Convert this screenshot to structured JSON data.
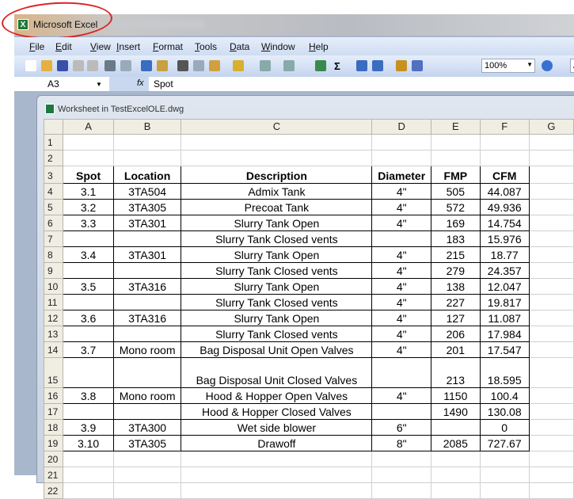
{
  "window": {
    "title": "Microsoft Excel"
  },
  "menu": [
    "File",
    "Edit",
    "View",
    "Insert",
    "Format",
    "Tools",
    "Data",
    "Window",
    "Help"
  ],
  "toolbar": {
    "zoom": "100%",
    "font": "Aria"
  },
  "formula_bar": {
    "cell": "A3",
    "fx": "fx",
    "value": "Spot"
  },
  "worksheet": {
    "title": "Worksheet in TestExcelOLE.dwg",
    "columns": [
      "A",
      "B",
      "C",
      "D",
      "E",
      "F",
      "G"
    ],
    "rows": [
      {
        "n": "1",
        "cells": [
          "",
          "",
          "",
          "",
          "",
          ""
        ]
      },
      {
        "n": "2",
        "cells": [
          "",
          "",
          "",
          "",
          "",
          ""
        ]
      },
      {
        "n": "3",
        "cells": [
          "Spot",
          "Location",
          "Description",
          "Diameter",
          "FMP",
          "CFM"
        ]
      },
      {
        "n": "4",
        "cells": [
          "3.1",
          "3TA504",
          "Admix Tank",
          "4\"",
          "505",
          "44.087"
        ]
      },
      {
        "n": "5",
        "cells": [
          "3.2",
          "3TA305",
          "Precoat Tank",
          "4\"",
          "572",
          "49.936"
        ]
      },
      {
        "n": "6",
        "cells": [
          "3.3",
          "3TA301",
          "Slurry Tank Open",
          "4\"",
          "169",
          "14.754"
        ]
      },
      {
        "n": "7",
        "cells": [
          "",
          "",
          "Slurry Tank Closed vents",
          "",
          "183",
          "15.976"
        ]
      },
      {
        "n": "8",
        "cells": [
          "3.4",
          "3TA301",
          "Slurry Tank Open",
          "4\"",
          "215",
          "18.77"
        ]
      },
      {
        "n": "9",
        "cells": [
          "",
          "",
          "Slurry Tank Closed vents",
          "4\"",
          "279",
          "24.357"
        ]
      },
      {
        "n": "10",
        "cells": [
          "3.5",
          "3TA316",
          "Slurry Tank Open",
          "4\"",
          "138",
          "12.047"
        ]
      },
      {
        "n": "11",
        "cells": [
          "",
          "",
          "Slurry Tank Closed vents",
          "4\"",
          "227",
          "19.817"
        ]
      },
      {
        "n": "12",
        "cells": [
          "3.6",
          "3TA316",
          "Slurry Tank Open",
          "4\"",
          "127",
          "11.087"
        ]
      },
      {
        "n": "13",
        "cells": [
          "",
          "",
          "Slurry Tank Closed vents",
          "4\"",
          "206",
          "17.984"
        ]
      },
      {
        "n": "14",
        "cells": [
          "3.7",
          "Mono room",
          "Bag Disposal Unit Open Valves",
          "4\"",
          "201",
          "17.547"
        ]
      },
      {
        "n": "15",
        "cells": [
          "",
          "",
          "Bag Disposal Unit Closed Valves",
          "",
          "213",
          "18.595"
        ]
      },
      {
        "n": "16",
        "cells": [
          "3.8",
          "Mono room",
          "Hood & Hopper Open Valves",
          "4\"",
          "1150",
          "100.4"
        ]
      },
      {
        "n": "17",
        "cells": [
          "",
          "",
          "Hood & Hopper Closed Valves",
          "",
          "1490",
          "130.08"
        ]
      },
      {
        "n": "18",
        "cells": [
          "3.9",
          "3TA300",
          "Wet side blower",
          "6\"",
          "",
          "0"
        ]
      },
      {
        "n": "19",
        "cells": [
          "3.10",
          "3TA305",
          "Drawoff",
          "8\"",
          "2085",
          "727.67"
        ]
      },
      {
        "n": "20",
        "cells": [
          "",
          "",
          "",
          "",
          "",
          ""
        ]
      },
      {
        "n": "21",
        "cells": [
          "",
          "",
          "",
          "",
          "",
          ""
        ]
      },
      {
        "n": "22",
        "cells": [
          "",
          "",
          "",
          "",
          "",
          ""
        ]
      }
    ]
  }
}
